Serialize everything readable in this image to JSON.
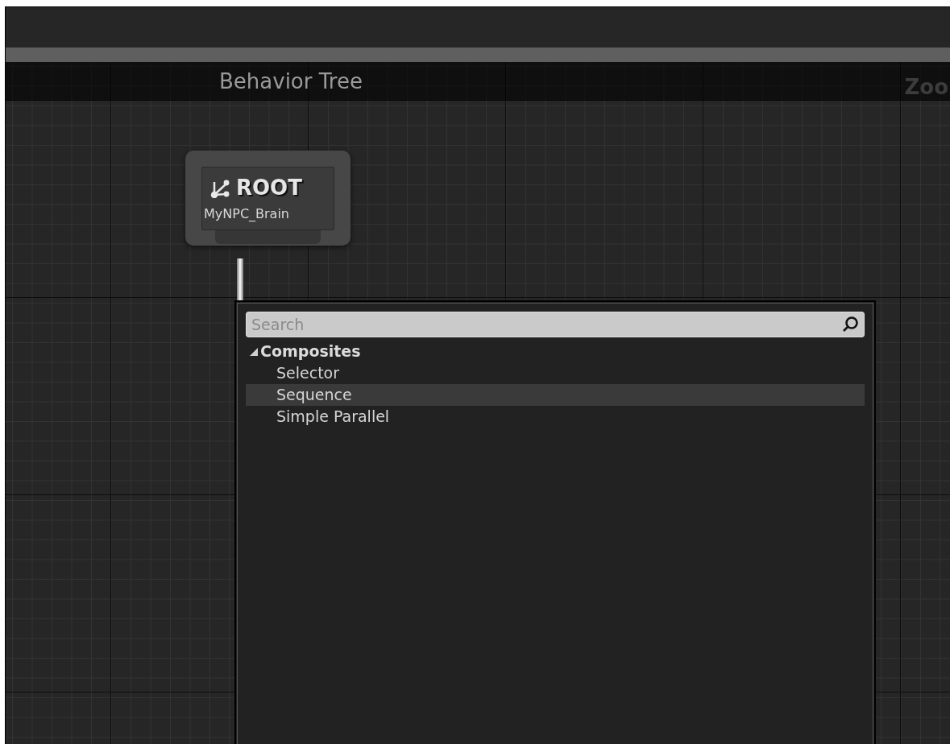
{
  "graph": {
    "title": "Behavior Tree",
    "zoom_label": "Zoo"
  },
  "root_node": {
    "title": "ROOT",
    "subtitle": "MyNPC_Brain"
  },
  "context_menu": {
    "search": {
      "placeholder": "Search"
    },
    "categories": [
      {
        "label": "Composites",
        "expanded": true,
        "children": [
          {
            "label": "Selector",
            "selected": false
          },
          {
            "label": "Sequence",
            "selected": true
          },
          {
            "label": "Simple Parallel",
            "selected": false
          }
        ]
      }
    ]
  }
}
